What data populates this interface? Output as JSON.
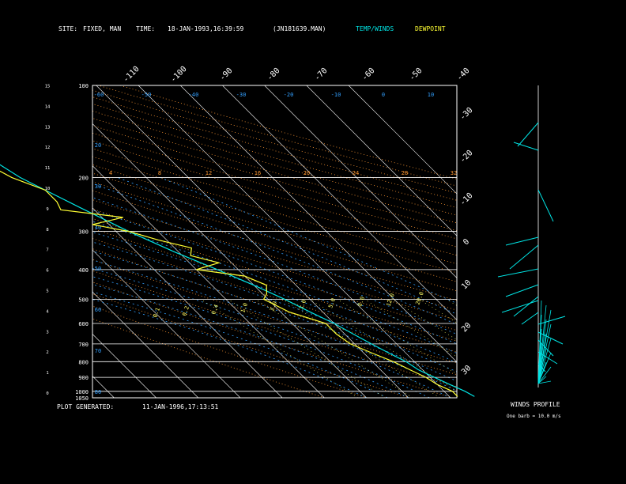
{
  "header": {
    "site_label": "SITE:",
    "site_value": "FIXED, MAN",
    "time_label": "TIME:",
    "time_value": "18-JAN-1993,16:39:59",
    "file": "(JN181639.MAN)",
    "legend_temp": "TEMP/WINDS",
    "legend_dew": "DEWPOINT"
  },
  "footer": {
    "generated_label": "PLOT GENERATED:",
    "generated_value": "11-JAN-1996,17:13:51"
  },
  "winds_panel": {
    "title": "WINDS PROFILE",
    "note": "One barb = 10.0 m/s"
  },
  "colors": {
    "temp": "#00e5e5",
    "dewpoint": "#ffff33",
    "frame": "#ffffff",
    "isotherm": "#ffffff",
    "dry_adiabat": "#ff9933",
    "moist_adiabat": "#33a0ff",
    "mixing_ratio": "#ffff66"
  },
  "chart_data": {
    "type": "line",
    "chart_kind": "skew-T log-P diagram",
    "x_scale": "skewed temperature (°C)",
    "y_scale": "log pressure (hPa)",
    "pressure_levels": [
      100,
      200,
      300,
      400,
      500,
      600,
      700,
      800,
      900,
      1000,
      1050
    ],
    "left_height_ticks": [
      "0",
      "1",
      "2",
      "3",
      "4",
      "5",
      "6",
      "7",
      "8",
      "9",
      "10",
      "11",
      "12",
      "13",
      "14",
      "15"
    ],
    "top_temp_ticks": [
      "-110",
      "-100",
      "-90",
      "-80",
      "-70",
      "-60",
      "-50",
      "-40"
    ],
    "right_temp_ticks": [
      "-30",
      "-20",
      "-10",
      "0",
      "10",
      "20",
      "30"
    ],
    "dry_adiabat_labels": [
      "4",
      "8",
      "12",
      "16",
      "20",
      "24",
      "28",
      "32"
    ],
    "moist_adiabat_labels": [
      "-60",
      "-50",
      "-40",
      "-30",
      "-20",
      "-10",
      "0",
      "10",
      "20",
      "30",
      "40",
      "50",
      "60",
      "70",
      "80"
    ],
    "mixing_ratio_labels": [
      "0.1",
      "0.2",
      "0.4",
      "1.0",
      "2.0",
      "3.0",
      "5.0",
      "8.0",
      "12.0",
      "20.0"
    ],
    "series": [
      {
        "name": "TEMP/WINDS",
        "points": [
          {
            "p": 1040,
            "t": -4
          },
          {
            "p": 1000,
            "t": -5
          },
          {
            "p": 950,
            "t": -7
          },
          {
            "p": 900,
            "t": -9
          },
          {
            "p": 850,
            "t": -11
          },
          {
            "p": 800,
            "t": -12
          },
          {
            "p": 750,
            "t": -14
          },
          {
            "p": 700,
            "t": -16
          },
          {
            "p": 650,
            "t": -18
          },
          {
            "p": 600,
            "t": -20
          },
          {
            "p": 550,
            "t": -23
          },
          {
            "p": 500,
            "t": -26
          },
          {
            "p": 450,
            "t": -30
          },
          {
            "p": 400,
            "t": -35
          },
          {
            "p": 350,
            "t": -41
          },
          {
            "p": 300,
            "t": -47
          },
          {
            "p": 250,
            "t": -53
          },
          {
            "p": 220,
            "t": -57
          },
          {
            "p": 200,
            "t": -60
          },
          {
            "p": 170,
            "t": -63
          },
          {
            "p": 150,
            "t": -66
          },
          {
            "p": 130,
            "t": -70
          },
          {
            "p": 115,
            "t": -73
          },
          {
            "p": 100,
            "t": -73
          }
        ]
      },
      {
        "name": "DEWPOINT",
        "points": [
          {
            "p": 1040,
            "t": -8
          },
          {
            "p": 1000,
            "t": -8
          },
          {
            "p": 950,
            "t": -10
          },
          {
            "p": 900,
            "t": -11
          },
          {
            "p": 850,
            "t": -13
          },
          {
            "p": 800,
            "t": -15
          },
          {
            "p": 750,
            "t": -18
          },
          {
            "p": 700,
            "t": -21
          },
          {
            "p": 650,
            "t": -22
          },
          {
            "p": 600,
            "t": -22
          },
          {
            "p": 550,
            "t": -28
          },
          {
            "p": 500,
            "t": -31
          },
          {
            "p": 480,
            "t": -29
          },
          {
            "p": 450,
            "t": -27
          },
          {
            "p": 420,
            "t": -30
          },
          {
            "p": 400,
            "t": -40
          },
          {
            "p": 380,
            "t": -33
          },
          {
            "p": 360,
            "t": -38
          },
          {
            "p": 340,
            "t": -36
          },
          {
            "p": 320,
            "t": -42
          },
          {
            "p": 300,
            "t": -47
          },
          {
            "p": 285,
            "t": -54
          },
          {
            "p": 270,
            "t": -45
          },
          {
            "p": 255,
            "t": -58
          },
          {
            "p": 240,
            "t": -57
          },
          {
            "p": 220,
            "t": -57
          },
          {
            "p": 200,
            "t": -62
          },
          {
            "p": 160,
            "t": -68
          },
          {
            "p": 140,
            "t": -70
          },
          {
            "p": 120,
            "t": -75
          },
          {
            "p": 100,
            "t": -74
          }
        ]
      }
    ]
  }
}
